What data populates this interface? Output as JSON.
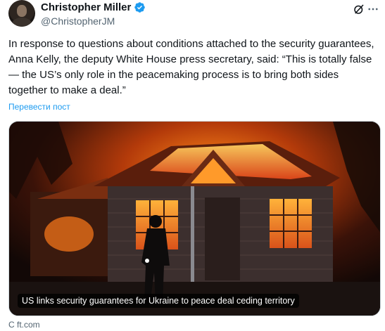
{
  "author": {
    "display_name": "Christopher Miller",
    "handle": "@ChristopherJM",
    "verified": true
  },
  "icons": {
    "verified": "verified-badge-icon",
    "grok": "grok-icon",
    "more": "more-options-icon"
  },
  "tweet": {
    "text": "In response to questions about conditions attached to the security guarantees, Anna Kelly, the deputy White House press secretary, said: “This is totally false — the US’s only role in the peacemaking process is to bring both sides together to make a deal.”",
    "translate_label": "Перевести пост"
  },
  "card": {
    "caption": "US links security guarantees for Ukraine to peace deal ceding territory",
    "source": "С ft.com"
  },
  "colors": {
    "accent": "#1d9bf0",
    "secondary_text": "#536471"
  }
}
